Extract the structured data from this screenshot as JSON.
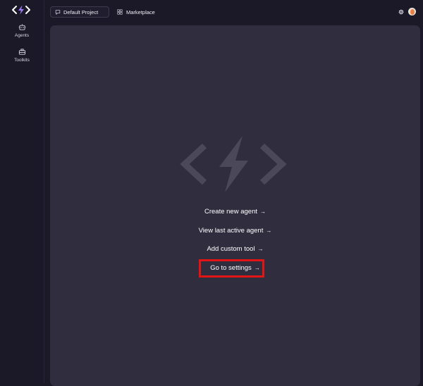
{
  "sidebar": {
    "items": [
      {
        "label": "Agents",
        "icon": "agents-icon"
      },
      {
        "label": "Toolkits",
        "icon": "toolkits-icon"
      }
    ]
  },
  "header": {
    "project_label": "Default Project",
    "marketplace_label": "Marketplace"
  },
  "main": {
    "actions": [
      {
        "label": "Create new agent",
        "arrow": "→"
      },
      {
        "label": "View last active agent",
        "arrow": "→"
      },
      {
        "label": "Add custom tool",
        "arrow": "→"
      },
      {
        "label": "Go to settings",
        "arrow": "→"
      }
    ]
  },
  "colors": {
    "background": "#1b1928",
    "panel": "#302d3f",
    "logo_accent": "#9b7cf4",
    "highlight": "#e31414"
  }
}
